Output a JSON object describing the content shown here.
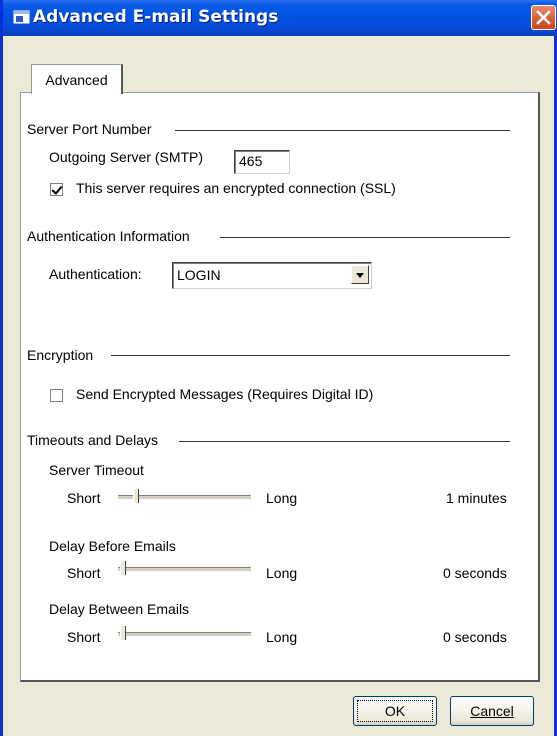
{
  "window": {
    "title": "Advanced E-mail Settings"
  },
  "tabs": [
    {
      "label": "Advanced"
    }
  ],
  "server_port": {
    "section_label": "Server Port Number",
    "smtp_label": "Outgoing Server (SMTP)",
    "smtp_value": "465",
    "ssl_label": "This server requires an encrypted connection (SSL)",
    "ssl_checked": true
  },
  "authentication": {
    "section_label": "Authentication Information",
    "label": "Authentication:",
    "selected": "LOGIN"
  },
  "encryption": {
    "section_label": "Encryption",
    "send_encrypted_label": "Send Encrypted Messages (Requires Digital ID)",
    "send_encrypted_checked": false
  },
  "timeouts": {
    "section_label": "Timeouts and Delays",
    "sliders": [
      {
        "label": "Server Timeout",
        "min_label": "Short",
        "max_label": "Long",
        "value_text": "1 minutes",
        "level": 0.1
      },
      {
        "label": "Delay Before Emails",
        "min_label": "Short",
        "max_label": "Long",
        "value_text": "0 seconds",
        "level": 0
      },
      {
        "label": "Delay Between Emails",
        "min_label": "Short",
        "max_label": "Long",
        "value_text": "0 seconds",
        "level": 0
      }
    ]
  },
  "buttons": {
    "ok": "OK",
    "cancel": "Cancel"
  },
  "icons": {
    "title": "app-window-icon",
    "close": "close-icon"
  }
}
